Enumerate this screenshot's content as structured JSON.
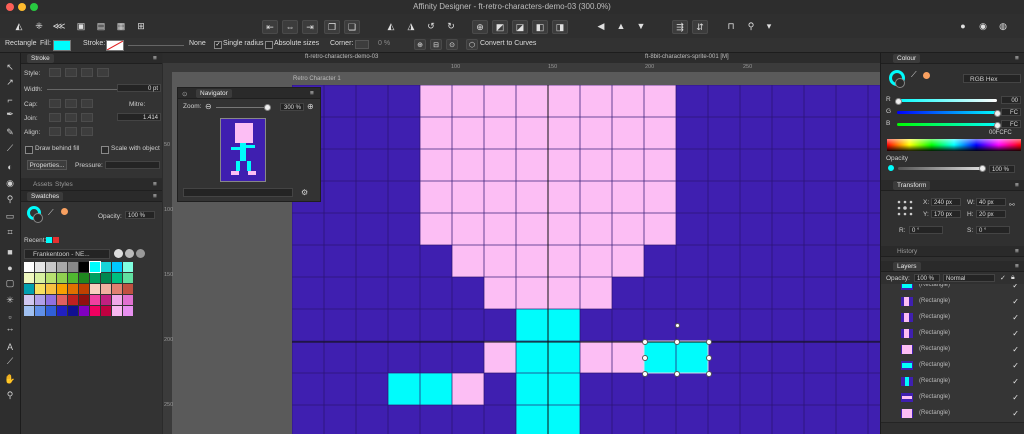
{
  "window": {
    "title": "Affinity Designer - ft-retro-characters-demo-03 (300.0%)"
  },
  "context_toolbar": {
    "tool": "Rectangle",
    "fill_label": "Fill:",
    "fill_color": "#00FCFC",
    "stroke_label": "Stroke:",
    "stroke_width_value": "None",
    "single_radius": "Single radius",
    "absolute_sizes": "Absolute sizes",
    "corner_label": "Corner:",
    "corner_value": "0 %",
    "convert_label": "Convert to Curves"
  },
  "doc_tabs": {
    "active": "ft-retro-characters-demo-03",
    "other": "ft-8bit-characters-sprite-001 [M]"
  },
  "ruler": {
    "h_ticks": [
      "100",
      "150",
      "200",
      "250"
    ],
    "v_ticks": [
      "50",
      "100",
      "150",
      "200",
      "250"
    ]
  },
  "artboard": {
    "label": "Retro Character 1"
  },
  "stroke_panel": {
    "tab": "Stroke",
    "style_label": "Style:",
    "width_label": "Width:",
    "width_value": "0 pt",
    "cap_label": "Cap:",
    "join_label": "Join:",
    "mitre_label": "Mitre:",
    "mitre_value": "1.414",
    "align_label": "Align:",
    "draw_behind_fill": "Draw behind fill",
    "scale_with_object": "Scale with object",
    "properties_button": "Properties...",
    "pressure_label": "Pressure:"
  },
  "assets_tabs": {
    "assets": "Assets",
    "styles": "Styles"
  },
  "swatches_panel": {
    "tab": "Swatches",
    "opacity_label": "Opacity:",
    "opacity_value": "100 %",
    "recent_label": "Recent:",
    "palette_name": "Frankentoon - NE...",
    "recent_colors": [
      "#00FCFC",
      "#E53030"
    ],
    "grid_colors": [
      "#ffffff",
      "#e6e6e6",
      "#c8c8c8",
      "#a8a8a8",
      "#888888",
      "#000000",
      "#00fcfc",
      "#18d4d8",
      "#00c8ff",
      "#80ffe0",
      "#f0f8c0",
      "#d8f0a0",
      "#b8e070",
      "#90d050",
      "#50b830",
      "#208820",
      "#00a060",
      "#008850",
      "#00c080",
      "#60e0a0",
      "#00a0b0",
      "#f8e060",
      "#f8c040",
      "#f8a000",
      "#e07000",
      "#c04000",
      "#f8d0c0",
      "#f0b0a0",
      "#e08070",
      "#c05040",
      "#d0c8f0",
      "#b0a0e8",
      "#9070e0",
      "#e06060",
      "#c02020",
      "#901010",
      "#f040a0",
      "#c02080",
      "#f0a8e8",
      "#e070d0",
      "#a0c0f0",
      "#6090e8",
      "#3060d8",
      "#2020c0",
      "#101090",
      "#8000c0",
      "#f00060",
      "#c00040",
      "#f8b8f0",
      "#e890f0"
    ]
  },
  "navigator": {
    "tab": "Navigator",
    "zoom_label": "Zoom:",
    "zoom_value": "300 %"
  },
  "colour_panel": {
    "tab": "Colour",
    "mode": "RGB Hex",
    "r_label": "R",
    "r_value": "00",
    "g_label": "G",
    "g_value": "FC",
    "b_label": "B",
    "b_value": "FC",
    "hex_value": "00FCFC",
    "opacity_label": "Opacity",
    "opacity_value": "100 %"
  },
  "transform_panel": {
    "tab": "Transform",
    "x_label": "X:",
    "x_value": "240 px",
    "y_label": "Y:",
    "y_value": "170 px",
    "w_label": "W:",
    "w_value": "40 px",
    "h_label": "H:",
    "h_value": "20 px",
    "r_label": "R:",
    "r_value": "0 °",
    "s_label": "S:",
    "s_value": "0 °"
  },
  "history_tab": "History",
  "layers_panel": {
    "tab": "Layers",
    "opacity_label": "Opacity:",
    "opacity_value": "100 %",
    "blend_mode": "Normal",
    "layers": [
      {
        "name": "(Rectangle)",
        "thumb": "cyan-h"
      },
      {
        "name": "(Rectangle)",
        "thumb": "pink-v"
      },
      {
        "name": "(Rectangle)",
        "thumb": "pink-v"
      },
      {
        "name": "(Rectangle)",
        "thumb": "pink-v"
      },
      {
        "name": "(Rectangle)",
        "thumb": "pink-block"
      },
      {
        "name": "(Rectangle)",
        "thumb": "cyan-h"
      },
      {
        "name": "(Rectangle)",
        "thumb": "cyan-v"
      },
      {
        "name": "(Rectangle)",
        "thumb": "pink-h"
      },
      {
        "name": "(Rectangle)",
        "thumb": "pink-block"
      }
    ]
  },
  "colors": {
    "artboard_bg": "#3F1FB0",
    "pink": "#FCBEF4",
    "cyan": "#00FCFC",
    "canvas_bg": "#5A5A5A"
  }
}
